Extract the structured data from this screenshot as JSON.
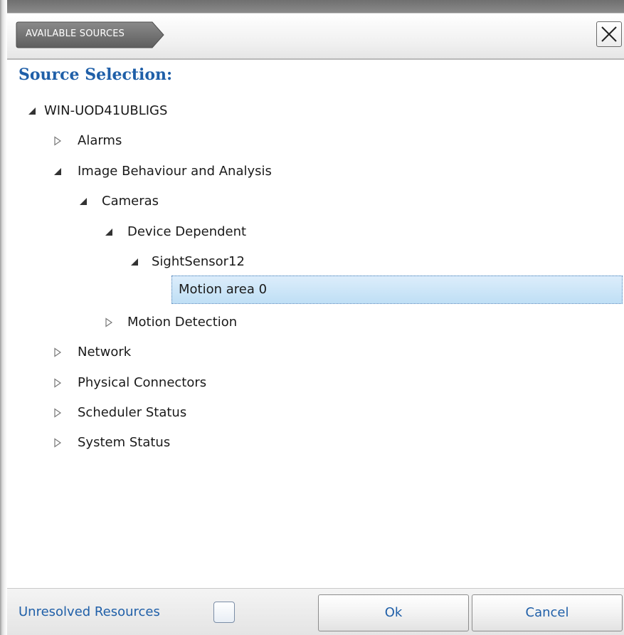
{
  "window": {
    "breadcrumb": "AVAILABLE SOURCES",
    "close_icon": "close-x-icon"
  },
  "panel": {
    "title": "Source Selection:"
  },
  "tree": {
    "root": {
      "label": "WIN-UOD41UBLIGS",
      "expanded": true
    },
    "items": [
      {
        "label": "Alarms",
        "expanded": false
      },
      {
        "label": "Image Behaviour and Analysis",
        "expanded": true
      },
      {
        "label": "Cameras",
        "expanded": true
      },
      {
        "label": "Device Dependent",
        "expanded": true
      },
      {
        "label": "SightSensor12",
        "expanded": true
      },
      {
        "label": "Motion area 0",
        "selected": true
      },
      {
        "label": "Motion Detection",
        "expanded": false
      },
      {
        "label": "Network",
        "expanded": false
      },
      {
        "label": "Physical Connectors",
        "expanded": false
      },
      {
        "label": "Scheduler Status",
        "expanded": false
      },
      {
        "label": "System Status",
        "expanded": false
      }
    ]
  },
  "footer": {
    "unresolved_label": "Unresolved Resources",
    "unresolved_checked": false,
    "ok_label": "Ok",
    "cancel_label": "Cancel"
  },
  "colors": {
    "accent": "#1f5fa8",
    "selection": "#bfdff5",
    "breadcrumb_bg": "#6e6e6e"
  }
}
